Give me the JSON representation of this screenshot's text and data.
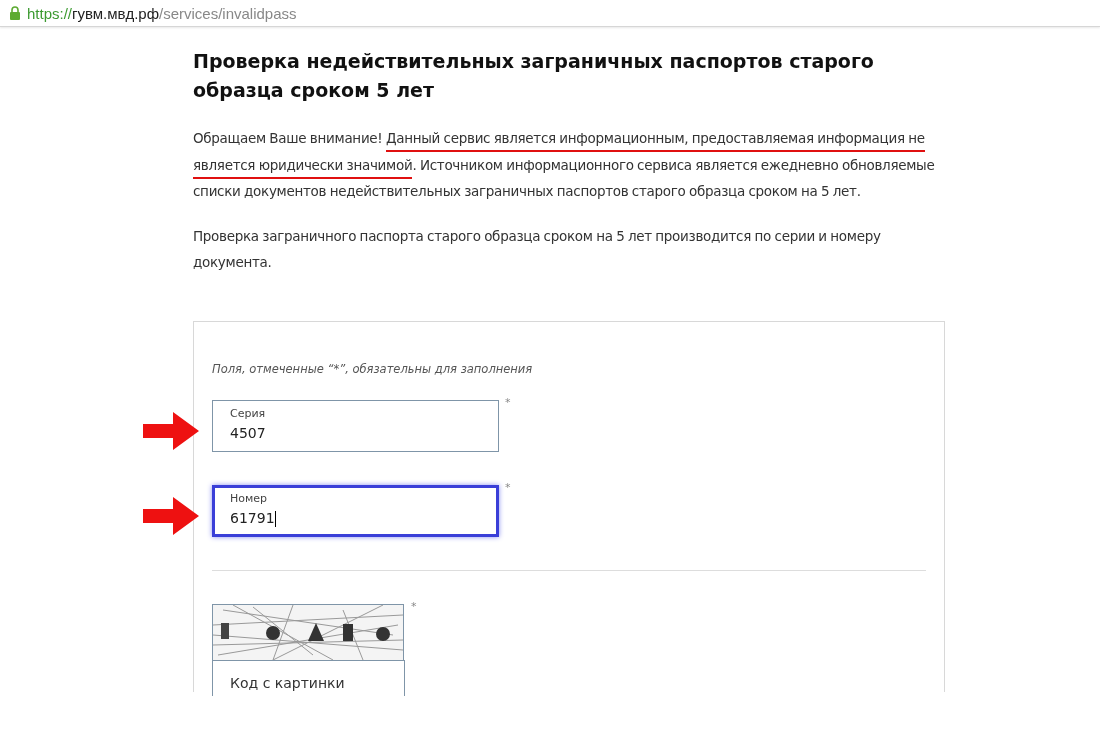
{
  "address_bar": {
    "secure": true,
    "scheme": "https://",
    "host": "гувм.мвд.рф",
    "path": "/services/invalidpass"
  },
  "title": "Проверка недействительных заграничных паспортов старого образца сроком 5 лет",
  "paragraphs": [
    [
      {
        "text": "Обращаем Ваше внимание! ",
        "underlined": false
      },
      {
        "text": "Данный сервис является информационным, предоставляемая информация не является юридически значимой",
        "underlined": true
      },
      {
        "text": ". Источником информационного сервиса является ежедневно обновляемые списки документов недействительных заграничных паспортов старого образца сроком на 5 лет.",
        "underlined": false
      }
    ],
    [
      {
        "text": "Проверка заграничного паспорта старого образца сроком на 5 лет производится по серии и номеру документа.",
        "underlined": false
      }
    ]
  ],
  "form": {
    "note": "Поля, отмеченные “*”, обязательны для заполнения",
    "fields": [
      {
        "label": "Серия",
        "value": "4507",
        "required_mark": "*",
        "focused": false,
        "arrow": true
      },
      {
        "label": "Номер",
        "value": "61791",
        "required_mark": "*",
        "focused": true,
        "arrow": true
      }
    ],
    "captcha": {
      "kind": "picture",
      "required_mark": "*",
      "placeholder": "Код с картинки"
    }
  }
}
